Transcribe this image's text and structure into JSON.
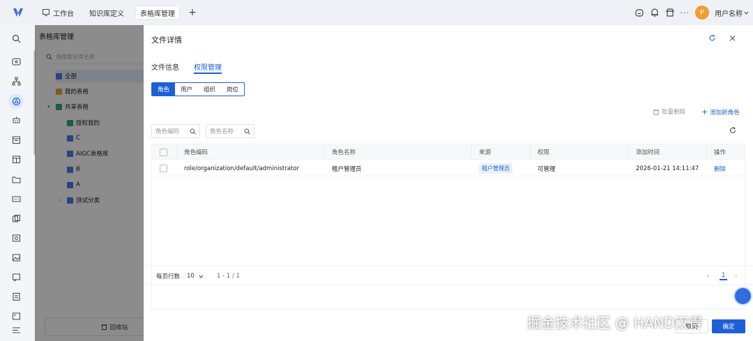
{
  "topbar": {
    "tabs": [
      {
        "label": "工作台",
        "icon": "monitor-icon"
      },
      {
        "label": "知识库定义"
      },
      {
        "label": "表格库管理",
        "active": true
      }
    ],
    "avatar_letter": "P",
    "username": "用户名称",
    "more": "···"
  },
  "tree": {
    "title": "表格库管理",
    "search_placeholder": "请搜索分类名称",
    "nodes": [
      {
        "label": "全部",
        "selected": true
      },
      {
        "label": "我的表格"
      },
      {
        "label": "共享表格"
      },
      {
        "label": "授权我的"
      },
      {
        "label": "C"
      },
      {
        "label": "AIGC表格库"
      },
      {
        "label": "B"
      },
      {
        "label": "A"
      },
      {
        "label": "测试分类"
      }
    ],
    "recycle_label": "回收站"
  },
  "drawer": {
    "title": "文件详情",
    "tabs": [
      "文件信息",
      "权限管理"
    ],
    "active_tab": "权限管理",
    "segments": [
      "角色",
      "用户",
      "组织",
      "岗位"
    ],
    "active_segment": "角色",
    "batch_delete": "批量删除",
    "add_role": "添加新角色",
    "filters": {
      "role_code": "角色编码",
      "role_name": "角色名称"
    },
    "table": {
      "columns": [
        "角色编码",
        "角色名称",
        "来源",
        "权限",
        "添加时间",
        "操作"
      ],
      "rows": [
        {
          "code": "role/organization/default/administrator",
          "name": "租户管理员",
          "source": "租户管理员",
          "permission": "可管理",
          "added": "2026-01-21 14:11:47",
          "action": "删除"
        }
      ]
    },
    "pager": {
      "rows_label": "每页行数",
      "page_size": "10",
      "range": "1 - 1 / 1",
      "current_page": "1"
    },
    "cancel": "取消",
    "confirm": "确定"
  },
  "watermark": "掘金技术社区 @ HAND汉得",
  "colors": {
    "primary": "#1f5fd6",
    "avatar": "#f39c34"
  }
}
